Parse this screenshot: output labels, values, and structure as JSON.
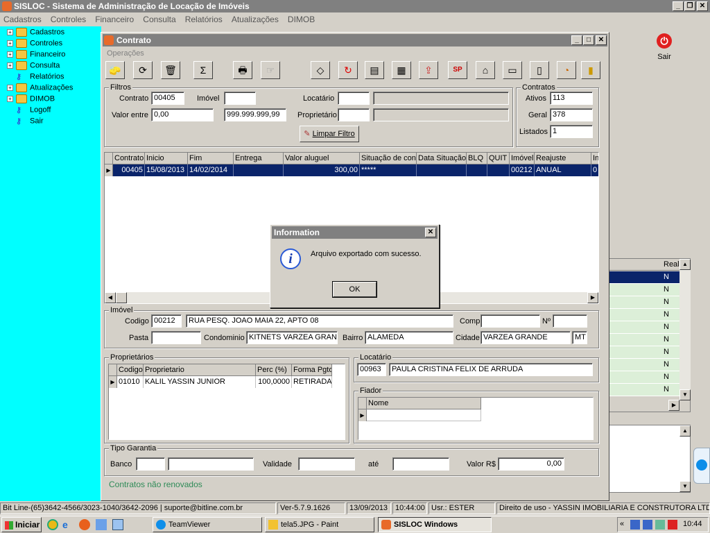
{
  "app": {
    "title": "SISLOC - Sistema de Administração de Locação de Imóveis",
    "menu": [
      "Cadastros",
      "Controles",
      "Financeiro",
      "Consulta",
      "Relatórios",
      "Atualizações",
      "DIMOB"
    ],
    "sair_label": "Sair",
    "tree": [
      {
        "label": "Cadastros",
        "icon": "folder-icon",
        "expandable": true
      },
      {
        "label": "Controles",
        "icon": "folder-icon",
        "expandable": true
      },
      {
        "label": "Financeiro",
        "icon": "folder-icon",
        "expandable": true
      },
      {
        "label": "Consulta",
        "icon": "folder-icon",
        "expandable": true
      },
      {
        "label": "Relatórios",
        "icon": "key-icon",
        "expandable": false
      },
      {
        "label": "Atualizações",
        "icon": "folder-icon",
        "expandable": true
      },
      {
        "label": "DIMOB",
        "icon": "folder-icon",
        "expandable": true
      },
      {
        "label": "Logoff",
        "icon": "key-icon",
        "expandable": false
      },
      {
        "label": "Sair",
        "icon": "key-icon",
        "expandable": false
      }
    ],
    "background_grid": {
      "header": "Real",
      "values": [
        "N",
        "N",
        "N",
        "N",
        "N",
        "N",
        "N",
        "N",
        "N",
        "N"
      ]
    }
  },
  "contrato": {
    "title": "Contrato",
    "menu_label": "Operações",
    "filtros": {
      "group_label": "Filtros",
      "contrato_label": "Contrato",
      "contrato_value": "00405",
      "imovel_label": "Imóvel",
      "imovel_value": "",
      "locatario_label": "Locatário",
      "locatario_value": "",
      "valor_entre_label": "Valor entre",
      "valor_min": "0,00",
      "valor_max": "999.999.999,99",
      "proprietario_label": "Proprietário",
      "proprietario_value": "",
      "limpar_label": "Limpar Filtro"
    },
    "contratos": {
      "group_label": "Contratos",
      "ativos_label": "Ativos",
      "ativos_value": "113",
      "geral_label": "Geral",
      "geral_value": "378",
      "listados_label": "Listados",
      "listados_value": "1"
    },
    "grid": {
      "columns": [
        "Contrato",
        "Inicio",
        "Fim",
        "Entrega",
        "Valor aluguel",
        "Situação de con",
        "Data Situação",
        "BLQ",
        "QUIT",
        "Imóvel",
        "Reajuste",
        "In"
      ],
      "rows": [
        [
          "00405",
          "15/08/2013",
          "14/02/2014",
          "",
          "300,00",
          "*****",
          "",
          "",
          "",
          "00212",
          "ANUAL",
          "0"
        ]
      ]
    },
    "imovel": {
      "group_label": "Imóvel",
      "codigo_label": "Codigo",
      "codigo_value": "00212",
      "endereco_value": "RUA PESQ. JOAO MAIA 22, APTO 08",
      "compl_label": "Compl",
      "compl_value": "",
      "numero_label": "Nº",
      "numero_value": "",
      "pasta_label": "Pasta",
      "pasta_value": "",
      "condominio_label": "Condominio",
      "condominio_value": "KITNETS VARZEA GRAN",
      "bairro_label": "Bairro",
      "bairro_value": "ALAMEDA",
      "cidade_label": "Cidade",
      "cidade_value": "VARZEA GRANDE",
      "uf_value": "MT"
    },
    "proprietarios": {
      "group_label": "Proprietários",
      "columns": [
        "Codigo",
        "Proprietario",
        "Perc (%)",
        "Forma Pgto"
      ],
      "rows": [
        [
          "01010",
          "KALIL YASSIN JUNIOR",
          "100,0000",
          "RETIRADA"
        ]
      ]
    },
    "locatario": {
      "group_label": "Locatário",
      "codigo_value": "00963",
      "nome_value": "PAULA CRISTINA FELIX DE ARRUDA"
    },
    "fiador": {
      "group_label": "Fiador",
      "columns": [
        "Nome"
      ]
    },
    "garantia": {
      "group_label": "Tipo Garantia",
      "banco_label": "Banco",
      "banco_value": "",
      "banco_nome_value": "",
      "validade_label": "Validade",
      "validade_value": "",
      "ate_label": "até",
      "ate_value": "",
      "valor_label": "Valor R$",
      "valor_value": "0,00"
    },
    "footer_link": "Contratos não renovados"
  },
  "dialog": {
    "title": "Information",
    "message": "Arquivo exportado com sucesso.",
    "ok_label": "OK",
    "icon": "info-icon"
  },
  "statusbar": [
    "Bit Line-(65)3642-4566/3023-1040/3642-2096 | suporte@bitline.com.br",
    "Ver-5.7.9.1626",
    "13/09/2013",
    "10:44:00",
    "Usr.: ESTER",
    "Direito de uso - YASSIN IMOBILIARIA E CONSTRUTORA LTDA"
  ],
  "taskbar": {
    "start_label": "Iniciar",
    "tasks": [
      "TeamViewer",
      "tela5.JPG - Paint",
      "SISLOC Windows"
    ],
    "clock": "10:44"
  }
}
